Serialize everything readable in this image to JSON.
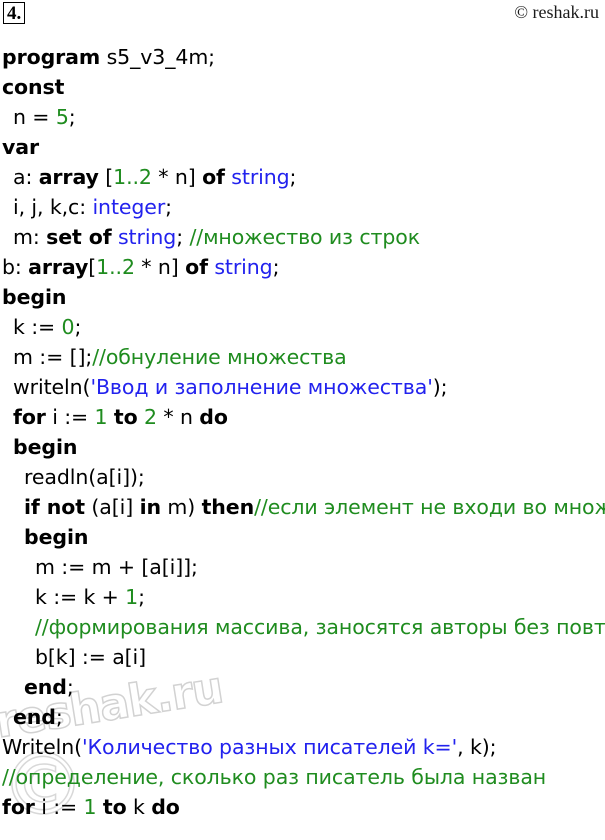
{
  "header": {
    "task_number": "4.",
    "copyright": "© reshak.ru"
  },
  "watermark": {
    "text": "reshak.ru",
    "symbol": "©"
  },
  "colors": {
    "keyword": "#000000",
    "number": "#1f8c1f",
    "type": "#2222ee",
    "string": "#2222ee",
    "comment": "#1f8c1f",
    "background": "#ffffff"
  },
  "code": {
    "language": "Pascal",
    "lines": [
      {
        "indent": 0,
        "tokens": [
          {
            "t": "program",
            "c": "kw"
          },
          {
            "t": " s5_v3_4m;",
            "c": "pl"
          }
        ]
      },
      {
        "indent": 0,
        "tokens": [
          {
            "t": "const",
            "c": "kw"
          }
        ]
      },
      {
        "indent": 1,
        "tokens": [
          {
            "t": "n = ",
            "c": "pl"
          },
          {
            "t": "5",
            "c": "num"
          },
          {
            "t": ";",
            "c": "pl"
          }
        ]
      },
      {
        "indent": 0,
        "tokens": [
          {
            "t": "var",
            "c": "kw"
          }
        ]
      },
      {
        "indent": 1,
        "tokens": [
          {
            "t": "a: ",
            "c": "pl"
          },
          {
            "t": "array",
            "c": "kw"
          },
          {
            "t": " [",
            "c": "pl"
          },
          {
            "t": "1..2",
            "c": "num"
          },
          {
            "t": " * n] ",
            "c": "pl"
          },
          {
            "t": "of",
            "c": "kw"
          },
          {
            "t": " ",
            "c": "pl"
          },
          {
            "t": "string",
            "c": "type"
          },
          {
            "t": ";",
            "c": "pl"
          }
        ]
      },
      {
        "indent": 1,
        "tokens": [
          {
            "t": "i, j, k,c: ",
            "c": "pl"
          },
          {
            "t": "integer",
            "c": "type"
          },
          {
            "t": ";",
            "c": "pl"
          }
        ]
      },
      {
        "indent": 1,
        "tokens": [
          {
            "t": "m: ",
            "c": "pl"
          },
          {
            "t": "set of",
            "c": "kw"
          },
          {
            "t": " ",
            "c": "pl"
          },
          {
            "t": "string",
            "c": "type"
          },
          {
            "t": "; ",
            "c": "pl"
          },
          {
            "t": "//множество из строк",
            "c": "cmt"
          }
        ]
      },
      {
        "indent": 0,
        "tokens": [
          {
            "t": "b: ",
            "c": "pl"
          },
          {
            "t": "array",
            "c": "kw"
          },
          {
            "t": "[",
            "c": "pl"
          },
          {
            "t": "1..2",
            "c": "num"
          },
          {
            "t": " * n] ",
            "c": "pl"
          },
          {
            "t": "of",
            "c": "kw"
          },
          {
            "t": " ",
            "c": "pl"
          },
          {
            "t": "string",
            "c": "type"
          },
          {
            "t": ";",
            "c": "pl"
          }
        ]
      },
      {
        "indent": 0,
        "tokens": [
          {
            "t": "begin",
            "c": "kw"
          }
        ]
      },
      {
        "indent": 1,
        "tokens": [
          {
            "t": "k := ",
            "c": "pl"
          },
          {
            "t": "0",
            "c": "num"
          },
          {
            "t": ";",
            "c": "pl"
          }
        ]
      },
      {
        "indent": 1,
        "tokens": [
          {
            "t": "m := [];",
            "c": "pl"
          },
          {
            "t": "//обнуление множества",
            "c": "cmt"
          }
        ]
      },
      {
        "indent": 1,
        "tokens": [
          {
            "t": "writeln(",
            "c": "pl"
          },
          {
            "t": "'Ввод и заполнение множества'",
            "c": "str"
          },
          {
            "t": ");",
            "c": "pl"
          }
        ]
      },
      {
        "indent": 1,
        "tokens": [
          {
            "t": "for",
            "c": "kw"
          },
          {
            "t": " i := ",
            "c": "pl"
          },
          {
            "t": "1",
            "c": "num"
          },
          {
            "t": " ",
            "c": "pl"
          },
          {
            "t": "to",
            "c": "kw"
          },
          {
            "t": " ",
            "c": "pl"
          },
          {
            "t": "2",
            "c": "num"
          },
          {
            "t": " * n ",
            "c": "pl"
          },
          {
            "t": "do",
            "c": "kw"
          }
        ]
      },
      {
        "indent": 1,
        "tokens": [
          {
            "t": "begin",
            "c": "kw"
          }
        ]
      },
      {
        "indent": 2,
        "tokens": [
          {
            "t": "readln(a[i]);",
            "c": "pl"
          }
        ]
      },
      {
        "indent": 2,
        "tokens": [
          {
            "t": "if not",
            "c": "kw"
          },
          {
            "t": " (a[i] ",
            "c": "pl"
          },
          {
            "t": "in",
            "c": "kw"
          },
          {
            "t": " m) ",
            "c": "pl"
          },
          {
            "t": "then",
            "c": "kw"
          },
          {
            "t": "//если элемент не входи во множество",
            "c": "cmt"
          }
        ]
      },
      {
        "indent": 2,
        "tokens": [
          {
            "t": "begin",
            "c": "kw"
          }
        ]
      },
      {
        "indent": 3,
        "tokens": [
          {
            "t": "m := m + [a[i]];",
            "c": "pl"
          }
        ]
      },
      {
        "indent": 3,
        "tokens": [
          {
            "t": "k := k + ",
            "c": "pl"
          },
          {
            "t": "1",
            "c": "num"
          },
          {
            "t": ";",
            "c": "pl"
          }
        ]
      },
      {
        "indent": 3,
        "tokens": [
          {
            "t": "//формирования массива, заносятся авторы без повторения",
            "c": "cmt"
          }
        ]
      },
      {
        "indent": 3,
        "tokens": [
          {
            "t": "b[k] := a[i]",
            "c": "pl"
          }
        ]
      },
      {
        "indent": 2,
        "tokens": [
          {
            "t": "end",
            "c": "kw"
          },
          {
            "t": ";",
            "c": "pl"
          }
        ]
      },
      {
        "indent": 1,
        "tokens": [
          {
            "t": "end",
            "c": "kw"
          },
          {
            "t": ";",
            "c": "pl"
          }
        ]
      },
      {
        "indent": 0,
        "tokens": [
          {
            "t": "Writeln(",
            "c": "pl"
          },
          {
            "t": "'Количество разных писателей k='",
            "c": "str"
          },
          {
            "t": ", k);",
            "c": "pl"
          }
        ]
      },
      {
        "indent": 0,
        "tokens": [
          {
            "t": "//определение, сколько раз писатель была назван",
            "c": "cmt"
          }
        ]
      },
      {
        "indent": 0,
        "tokens": [
          {
            "t": "for",
            "c": "kw"
          },
          {
            "t": " i := ",
            "c": "pl"
          },
          {
            "t": "1",
            "c": "num"
          },
          {
            "t": " ",
            "c": "pl"
          },
          {
            "t": "to",
            "c": "kw"
          },
          {
            "t": " k ",
            "c": "pl"
          },
          {
            "t": "do",
            "c": "kw"
          }
        ]
      }
    ]
  }
}
